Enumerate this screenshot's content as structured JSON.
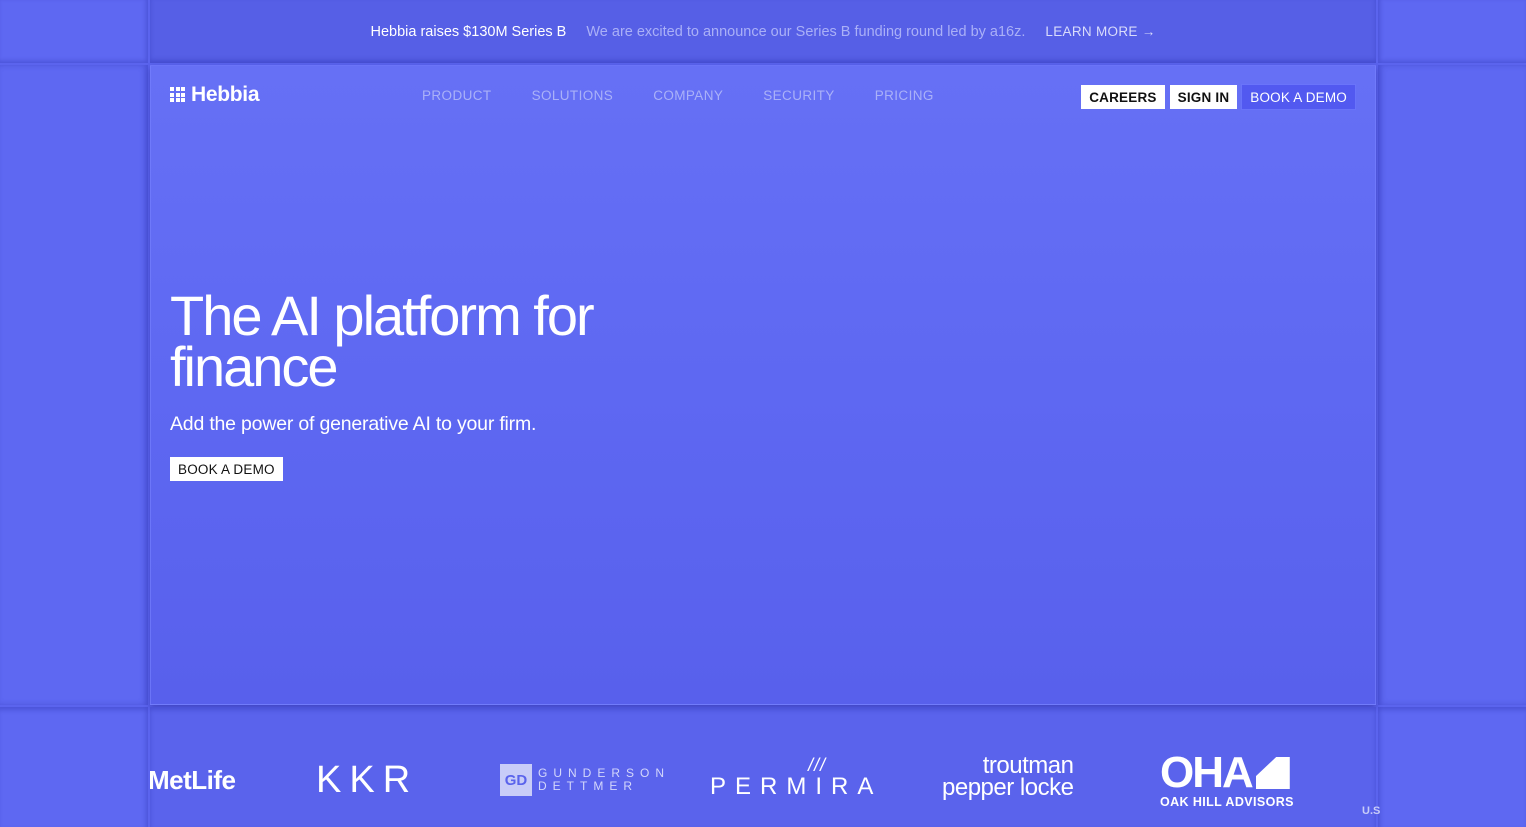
{
  "announcement": {
    "headline": "Hebbia raises $130M Series B",
    "message": "We are excited to announce our Series B funding round led by a16z.",
    "link_label": "LEARN MORE",
    "link_arrow": "→"
  },
  "nav": {
    "brand": "Hebbia",
    "links": [
      {
        "label": "PRODUCT"
      },
      {
        "label": "SOLUTIONS"
      },
      {
        "label": "COMPANY"
      },
      {
        "label": "SECURITY"
      },
      {
        "label": "PRICING"
      }
    ],
    "careers_label": "CAREERS",
    "signin_label": "SIGN IN",
    "demo_label": "BOOK A DEMO"
  },
  "hero": {
    "title": "The AI platform for finance",
    "subtitle": "Add the power of generative AI to your firm.",
    "cta_label": "BOOK A DEMO"
  },
  "logos": {
    "metlife": "MetLife",
    "kkr": "KKR",
    "gunderson_mark": "GD",
    "gunderson_line1": "GUNDERSON",
    "gunderson_line2": "DETTMER",
    "permira_mark": "///",
    "permira": "PERMIRA",
    "troutman_line1": "troutman",
    "troutman_line2": "pepper locke",
    "oha_big": "OHA",
    "oha_small": "OAK HILL ADVISORS",
    "partial": "U.S"
  },
  "colors": {
    "background": "#5b64ee",
    "accent_button": "#5259f0"
  }
}
